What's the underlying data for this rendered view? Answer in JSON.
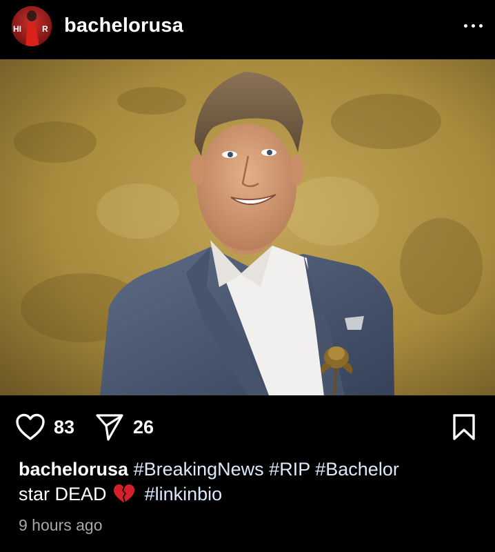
{
  "post": {
    "username": "bachelorusa",
    "avatar_text": "HI R"
  },
  "actions": {
    "like_count": "83",
    "share_count": "26"
  },
  "caption": {
    "username": "bachelorusa",
    "tags_line1": [
      "#BreakingNews",
      "#RIP",
      "#Bachelor"
    ],
    "text": "star DEAD",
    "emoji": "broken-heart",
    "tags_line2": [
      "#linkinbio"
    ]
  },
  "timestamp": "9 hours ago",
  "colors": {
    "background": "#000000",
    "text": "#ffffff",
    "hashtag": "#dbe9ff",
    "timestamp": "#a8a8a8",
    "photo_backdrop": "#a88a3c"
  }
}
